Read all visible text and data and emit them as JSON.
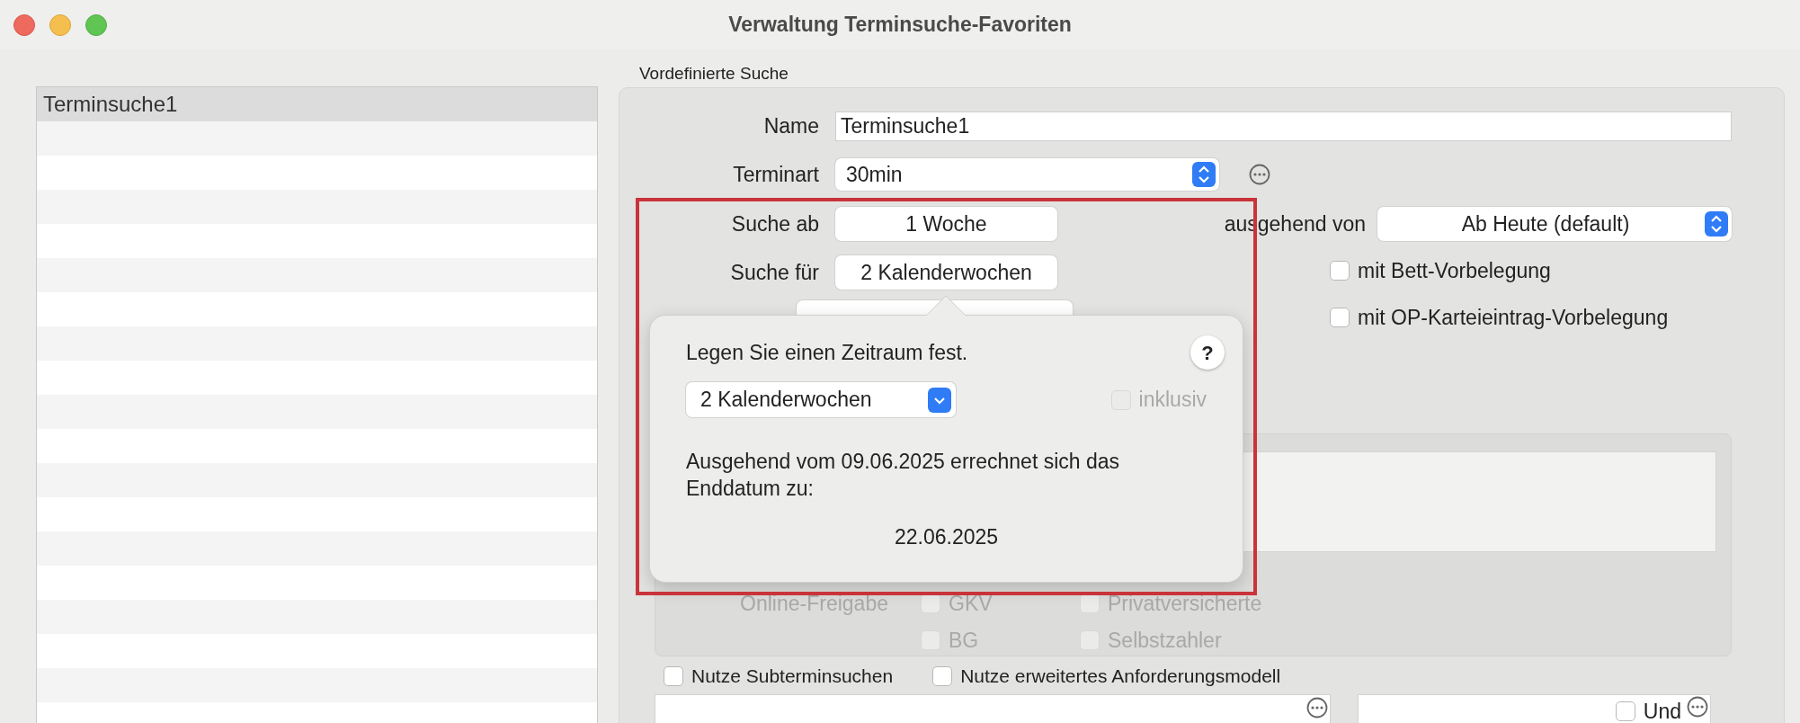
{
  "window": {
    "title": "Verwaltung Terminsuche-Favoriten"
  },
  "favorites": [
    {
      "label": "Terminsuche1",
      "selected": true
    }
  ],
  "group_title": "Vordefinierte Suche",
  "form": {
    "name": {
      "label": "Name",
      "value": "Terminsuche1"
    },
    "terminart": {
      "label": "Terminart",
      "value": "30min"
    },
    "suche_ab": {
      "label": "Suche ab",
      "value": "1 Woche"
    },
    "ausgehend_von": {
      "label": "ausgehend von",
      "value": "Ab Heute (default)"
    },
    "suche_fuer": {
      "label": "Suche für",
      "value": "2 Kalenderwochen"
    }
  },
  "options": [
    {
      "label": "mit Bett-Vorbelegung",
      "checked": false
    },
    {
      "label": "mit OP-Karteieintrag-Vorbelegung",
      "checked": false
    }
  ],
  "online": {
    "label": "Online-Freigabe",
    "items": [
      {
        "label": "GKV",
        "checked": false,
        "disabled": true
      },
      {
        "label": "Privatversicherte",
        "checked": false,
        "disabled": true
      },
      {
        "label": "BG",
        "checked": false,
        "disabled": true
      },
      {
        "label": "Selbstzahler",
        "checked": false,
        "disabled": true
      }
    ]
  },
  "bottom_options": [
    {
      "label": "Nutze Subterminsuchen",
      "checked": false
    },
    {
      "label": "Nutze erweitertes Anforderungsmodell",
      "checked": false
    }
  ],
  "und": {
    "label": "Und",
    "checked": false
  },
  "popover": {
    "title": "Legen Sie einen Zeitraum fest.",
    "help": "?",
    "period": "2 Kalenderwochen",
    "inklusiv": {
      "label": "inklusiv",
      "checked": false,
      "disabled": true
    },
    "message": "Ausgehend vom 09.06.2025 errechnet sich das Enddatum zu:",
    "result": "22.06.2025"
  }
}
